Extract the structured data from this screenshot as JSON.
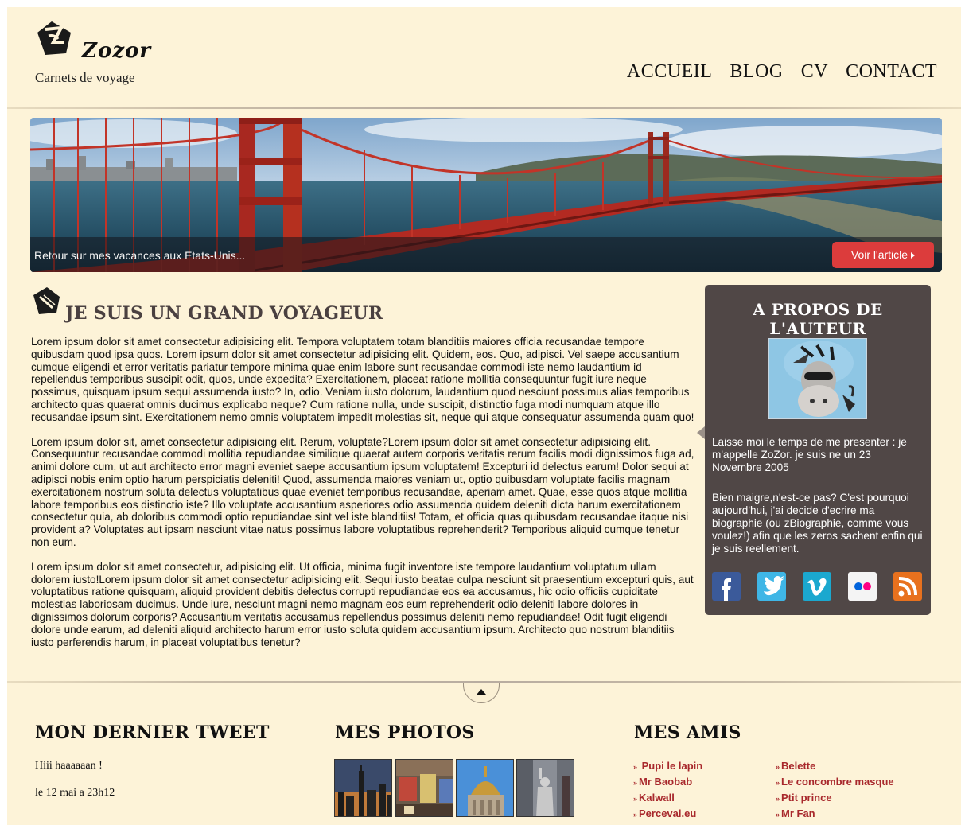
{
  "header": {
    "logo_name": "Zozor",
    "tagline": "Carnets de voyage",
    "nav": [
      "ACCUEIL",
      "BLOG",
      "CV",
      "CONTACT"
    ]
  },
  "banner": {
    "caption": "Retour sur mes vacances aux Etats-Unis...",
    "button_label": "Voir l'article",
    "button_color": "#dc3c3c"
  },
  "article": {
    "icon": "pencil-icon",
    "title": "JE SUIS UN GRAND VOYAGEUR",
    "paragraphs": [
      "Lorem ipsum dolor sit amet consectetur adipisicing elit. Tempora voluptatem totam blanditiis maiores officia recusandae tempore quibusdam quod ipsa quos. Lorem ipsum dolor sit amet consectetur adipisicing elit. Quidem, eos. Quo, adipisci. Vel saepe accusantium cumque eligendi et error veritatis pariatur tempore minima quae enim labore sunt recusandae commodi iste nemo laudantium id repellendus temporibus suscipit odit, quos, unde expedita? Exercitationem, placeat ratione mollitia consequuntur fugit iure neque possimus, quisquam ipsum sequi assumenda iusto? In, odio. Veniam iusto dolorum, laudantium quod nesciunt possimus alias temporibus architecto quas quaerat omnis ducimus explicabo neque? Cum ratione nulla, unde suscipit, distinctio fuga modi numquam atque illo recusandae ipsum sint. Exercitationem nemo omnis voluptatem impedit molestias sit, neque qui atque consequatur assumenda quam quo!",
      "Lorem ipsum dolor sit, amet consectetur adipisicing elit. Rerum, voluptate?Lorem ipsum dolor sit amet consectetur adipisicing elit. Consequuntur recusandae commodi mollitia repudiandae similique quaerat autem corporis veritatis rerum facilis modi dignissimos fuga ad, animi dolore cum, ut aut architecto error magni eveniet saepe accusantium ipsum voluptatem! Excepturi id delectus earum! Dolor sequi at adipisci nobis enim optio harum perspiciatis deleniti! Quod, assumenda maiores veniam ut, optio quibusdam voluptate facilis magnam exercitationem nostrum soluta delectus voluptatibus quae eveniet temporibus recusandae, aperiam amet. Quae, esse quos atque mollitia labore temporibus eos distinctio iste? Illo voluptate accusantium asperiores odio assumenda quidem deleniti dicta harum exercitationem consectetur quia, ab doloribus commodi optio repudiandae sint vel iste blanditiis! Totam, et officia quas quibusdam recusandae itaque nisi provident a? Voluptates aut ipsam nesciunt vitae natus possimus labore voluptatibus reprehenderit? Temporibus aliquid cumque tenetur non eum.",
      "Lorem ipsum dolor sit amet consectetur, adipisicing elit. Ut officia, minima fugit inventore iste tempore laudantium voluptatum ullam dolorem iusto!Lorem ipsum dolor sit amet consectetur adipisicing elit. Sequi iusto beatae culpa nesciunt sit praesentium excepturi quis, aut voluptatibus ratione quisquam, aliquid provident debitis delectus corrupti repudiandae eos ea accusamus, hic odio officiis cupiditate molestias laboriosam ducimus. Unde iure, nesciunt magni nemo magnam eos eum reprehenderit odio deleniti labore dolores in dignissimos dolorum corporis? Accusantium veritatis accusamus repellendus possimus deleniti nemo repudiandae! Odit fugit eligendi dolore unde earum, ad deleniti aliquid architecto harum error iusto soluta quidem accusantium ipsum. Architecto quo nostrum blanditiis iusto perferendis harum, in placeat voluptatibus tenetur?"
    ]
  },
  "sidebar": {
    "title": "A PROPOS DE L'AUTEUR",
    "bio_1": "Laisse moi le temps de me presenter : je m'appelle ZoZor. je suis ne un 23 Novembre 2005",
    "bio_2": "Bien maigre,n'est-ce pas? C'est pourquoi aujourd'hui, j'ai decide d'ecrire ma biographie (ou zBiographie, comme vous voulez!) afin que les zeros sachent enfin qui je suis reellement.",
    "background_color": "#504746",
    "socials": [
      {
        "icon": "facebook-icon",
        "label": "f",
        "color": "#3b5a9a"
      },
      {
        "icon": "twitter-icon",
        "label": "",
        "color": "#3fb6e6"
      },
      {
        "icon": "vimeo-icon",
        "label": "v",
        "color": "#1ba8cf"
      },
      {
        "icon": "flickr-icon",
        "label": "",
        "color": "#f4f4f4"
      },
      {
        "icon": "rss-icon",
        "label": "",
        "color": "#e8711e"
      }
    ]
  },
  "footer": {
    "tweet_title": "MON DERNIER TWEET",
    "tweet_text": "Hiii haaaaaan !",
    "tweet_date": "le 12 mai a 23h12",
    "photos_title": "MES PHOTOS",
    "photos": [
      "new-york-skyline-photo",
      "street-market-photo",
      "golden-dome-photo",
      "statue-of-liberty-photo"
    ],
    "friends_title": "MES AMIS",
    "friends_col1": [
      " Pupi le lapin",
      "Mr Baobab",
      "Kalwall",
      "Perceval.eu"
    ],
    "friends_col2": [
      "Belette",
      "Le concombre masque",
      "Ptit prince",
      "Mr Fan"
    ],
    "link_color": "#a8282c"
  }
}
